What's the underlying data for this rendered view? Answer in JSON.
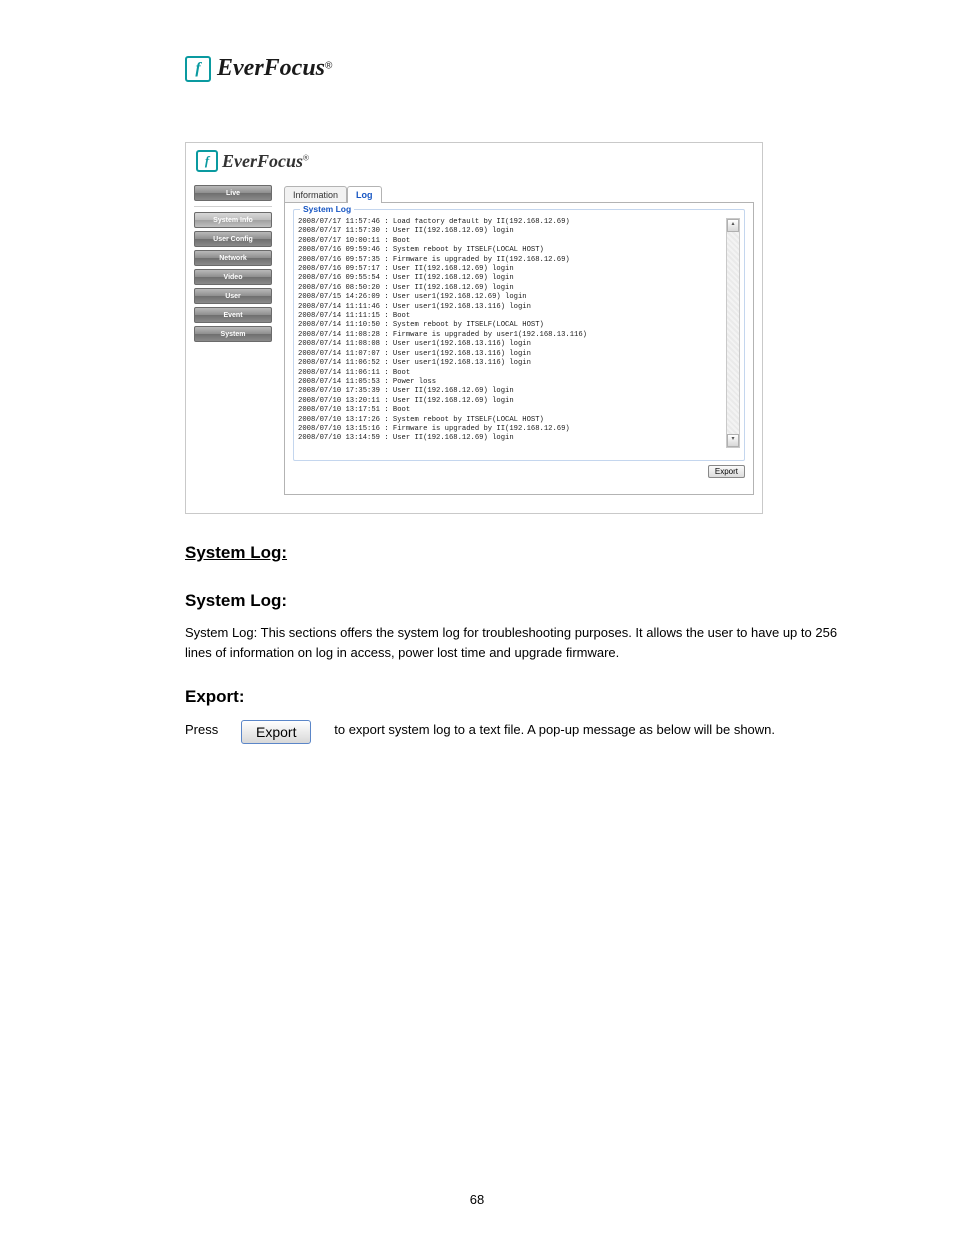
{
  "brand": {
    "name": "EverFocus",
    "reg": "®"
  },
  "shot": {
    "brand": {
      "name": "EverFocus",
      "reg": "®"
    },
    "sidebar": [
      {
        "label": "Live",
        "cls": ""
      },
      {
        "sep": true
      },
      {
        "label": "System Info",
        "cls": "active"
      },
      {
        "label": "User Config",
        "cls": ""
      },
      {
        "label": "Network",
        "cls": ""
      },
      {
        "label": "Video",
        "cls": ""
      },
      {
        "label": "User",
        "cls": ""
      },
      {
        "label": "Event",
        "cls": ""
      },
      {
        "label": "System",
        "cls": ""
      }
    ],
    "tabs": [
      {
        "label": "Information",
        "active": false
      },
      {
        "label": "Log",
        "active": true
      }
    ],
    "log_title": "System Log",
    "log_lines": [
      "2008/07/17 11:57:46 : Load factory default by II(192.168.12.69)",
      "2008/07/17 11:57:30 : User II(192.168.12.69) login",
      "2008/07/17 10:00:11 : Boot",
      "2008/07/16 09:59:46 : System reboot by ITSELF(LOCAL HOST)",
      "2008/07/16 09:57:35 : Firmware is upgraded by II(192.168.12.69)",
      "2008/07/16 09:57:17 : User II(192.168.12.69) login",
      "2008/07/16 09:55:54 : User II(192.168.12.69) login",
      "2008/07/16 08:50:20 : User II(192.168.12.69) login",
      "2008/07/15 14:26:09 : User user1(192.168.12.69) login",
      "2008/07/14 11:11:46 : User user1(192.168.13.116) login",
      "2008/07/14 11:11:15 : Boot",
      "2008/07/14 11:10:50 : System reboot by ITSELF(LOCAL HOST)",
      "2008/07/14 11:08:28 : Firmware is upgraded by user1(192.168.13.116)",
      "2008/07/14 11:08:08 : User user1(192.168.13.116) login",
      "2008/07/14 11:07:07 : User user1(192.168.13.116) login",
      "2008/07/14 11:06:52 : User user1(192.168.13.116) login",
      "2008/07/14 11:06:11 : Boot",
      "2008/07/14 11:05:53 : Power loss",
      "2008/07/10 17:35:39 : User II(192.168.12.69) login",
      "2008/07/10 13:20:11 : User II(192.168.12.69) login",
      "2008/07/10 13:17:51 : Boot",
      "2008/07/10 13:17:26 : System reboot by ITSELF(LOCAL HOST)",
      "2008/07/10 13:15:16 : Firmware is upgraded by II(192.168.12.69)",
      "2008/07/10 13:14:59 : User II(192.168.12.69) login"
    ],
    "export_label": "Export"
  },
  "doc": {
    "heading": "System Log:",
    "syslog_heading": "System Log:",
    "syslog_text": "System Log: This sections offers the system log for troubleshooting purposes. It allows the user to have up to 256 lines of information on log in access, power lost time and upgrade firmware.",
    "export_heading": "Export:",
    "export_btn": "Export",
    "export_text": "to export system log to a text file. A pop-up message as below will be shown.",
    "press": "Press"
  },
  "page_num": "68"
}
